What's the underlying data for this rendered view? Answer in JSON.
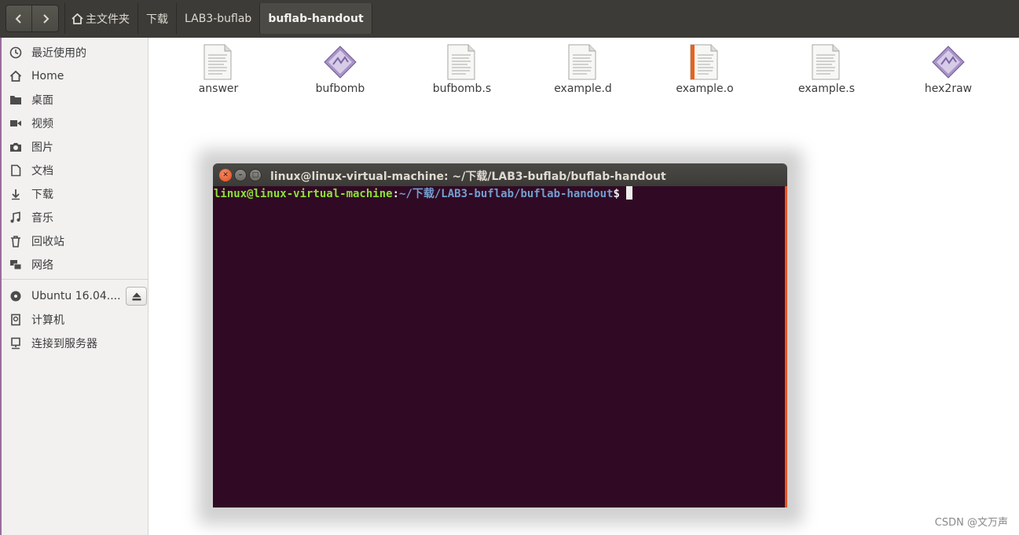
{
  "header": {
    "back_icon": "chevron-left-icon",
    "forward_icon": "chevron-right-icon",
    "breadcrumbs": [
      "主文件夹",
      "下载",
      "LAB3-buflab",
      "buflab-handout"
    ]
  },
  "sidebar": {
    "items": [
      {
        "label": "最近使用的",
        "icon": "clock-icon"
      },
      {
        "label": "Home",
        "icon": "home-icon"
      },
      {
        "label": "桌面",
        "icon": "folder-icon"
      },
      {
        "label": "视频",
        "icon": "video-icon"
      },
      {
        "label": "图片",
        "icon": "camera-icon"
      },
      {
        "label": "文档",
        "icon": "document-icon"
      },
      {
        "label": "下载",
        "icon": "download-icon"
      },
      {
        "label": "音乐",
        "icon": "music-icon"
      },
      {
        "label": "回收站",
        "icon": "trash-icon"
      },
      {
        "label": "网络",
        "icon": "network-icon"
      }
    ],
    "devices": [
      {
        "label": "Ubuntu 16.04....",
        "icon": "disc-icon"
      },
      {
        "label": "计算机",
        "icon": "drive-icon"
      },
      {
        "label": "连接到服务器",
        "icon": "server-icon"
      }
    ],
    "eject_icon": "eject-icon"
  },
  "files": [
    {
      "name": "answer",
      "type": "text"
    },
    {
      "name": "bufbomb",
      "type": "executable"
    },
    {
      "name": "bufbomb.s",
      "type": "text"
    },
    {
      "name": "example.d",
      "type": "text"
    },
    {
      "name": "example.o",
      "type": "object"
    },
    {
      "name": "example.s",
      "type": "text"
    },
    {
      "name": "hex2raw",
      "type": "executable"
    }
  ],
  "terminal": {
    "title": "linux@linux-virtual-machine: ~/下载/LAB3-buflab/buflab-handout",
    "prompt_user": "linux@linux-virtual-machine",
    "prompt_colon": ":",
    "prompt_path": "~/下载/LAB3-buflab/buflab-handout",
    "prompt_dollar": "$",
    "colors": {
      "background": "#300a24",
      "user": "#8ae234",
      "path": "#729fcf"
    }
  },
  "watermark": "CSDN @文万声"
}
